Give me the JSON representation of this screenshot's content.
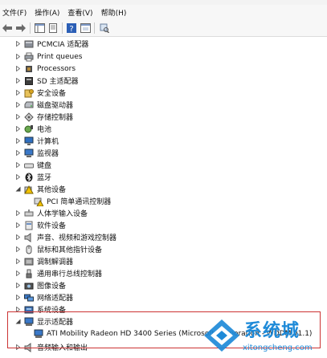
{
  "titlebar": {
    "partial_text": "- - -"
  },
  "menu": [
    "文件(F)",
    "操作(A)",
    "查看(V)",
    "帮助(H)"
  ],
  "tree": [
    {
      "label": "PCMCIA 适配器",
      "icon": "pcmcia-icon",
      "state": "collapsed"
    },
    {
      "label": "Print queues",
      "icon": "printer-icon",
      "state": "collapsed"
    },
    {
      "label": "Processors",
      "icon": "processor-icon",
      "state": "collapsed"
    },
    {
      "label": "SD 主适配器",
      "icon": "sd-host-icon",
      "state": "collapsed"
    },
    {
      "label": "安全设备",
      "icon": "security-device-icon",
      "state": "collapsed"
    },
    {
      "label": "磁盘驱动器",
      "icon": "disk-drive-icon",
      "state": "collapsed"
    },
    {
      "label": "存储控制器",
      "icon": "storage-controller-icon",
      "state": "collapsed"
    },
    {
      "label": "电池",
      "icon": "battery-icon",
      "state": "collapsed"
    },
    {
      "label": "计算机",
      "icon": "computer-icon",
      "state": "collapsed"
    },
    {
      "label": "监视器",
      "icon": "monitor-icon",
      "state": "collapsed"
    },
    {
      "label": "键盘",
      "icon": "keyboard-icon",
      "state": "collapsed"
    },
    {
      "label": "蓝牙",
      "icon": "bluetooth-icon",
      "state": "collapsed"
    },
    {
      "label": "其他设备",
      "icon": "other-devices-icon",
      "state": "expanded"
    },
    {
      "label": "PCI 简单通讯控制器",
      "icon": "unknown-device-warning-icon",
      "state": "child"
    },
    {
      "label": "人体学输入设备",
      "icon": "hid-icon",
      "state": "collapsed"
    },
    {
      "label": "软件设备",
      "icon": "software-device-icon",
      "state": "collapsed"
    },
    {
      "label": "声音、视频和游戏控制器",
      "icon": "sound-icon",
      "state": "collapsed"
    },
    {
      "label": "鼠标和其他指针设备",
      "icon": "mouse-icon",
      "state": "collapsed"
    },
    {
      "label": "调制解调器",
      "icon": "modem-icon",
      "state": "collapsed"
    },
    {
      "label": "通用串行总线控制器",
      "icon": "usb-icon",
      "state": "collapsed"
    },
    {
      "label": "图像设备",
      "icon": "imaging-device-icon",
      "state": "collapsed"
    },
    {
      "label": "网络适配器",
      "icon": "network-adapter-icon",
      "state": "collapsed"
    },
    {
      "label": "系统设备",
      "icon": "system-device-icon",
      "state": "collapsed"
    },
    {
      "label": "显示适配器",
      "icon": "display-adapter-icon",
      "state": "expanded"
    },
    {
      "label": "ATI Mobility Radeon HD 3400 Series (Microsoft Corporation - WDDM v1.1)",
      "icon": "display-card-icon",
      "state": "child"
    },
    {
      "label": "音频输入和输出",
      "icon": "audio-io-icon",
      "state": "collapsed"
    }
  ],
  "watermark": {
    "main": "系统城",
    "url": "xitongcheng.com"
  },
  "colors": {
    "selection_outline": "#cc3333",
    "watermark_blue": "#1e8ad8"
  }
}
